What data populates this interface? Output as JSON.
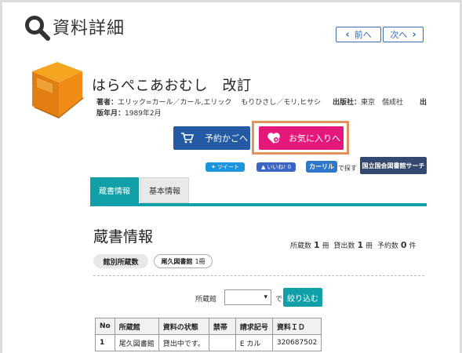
{
  "header": {
    "title": "資料詳細",
    "prev_label": "前へ",
    "next_label": "次へ"
  },
  "book": {
    "title": "はらぺこあおむし　改訂",
    "author_label": "著者：",
    "author_value": "エリック=カール／カール,エリック　 もりひさし／モリ,ヒサシ",
    "publisher_label": "出版社：",
    "publisher_value": "東京　偕成社",
    "publisher_overflow": "出",
    "date_label": "版年月：",
    "date_value": "1989年2月"
  },
  "actions": {
    "cart_label": "予約かごへ",
    "favorite_label": "お気に入りへ"
  },
  "social": {
    "tweet_label": "ツイート",
    "like_label": "いいね! 0",
    "calil_label": "カーリル",
    "calil_suffix": "で探す",
    "ndl_label": "国立国会図書館サーチ"
  },
  "tabs": [
    {
      "label": "蔵書情報",
      "active": true
    },
    {
      "label": "基本情報",
      "active": false
    }
  ],
  "holdings": {
    "title": "蔵書情報",
    "counts": {
      "owned_label": "所蔵数",
      "owned_value": "1",
      "owned_unit": "冊",
      "loaned_label": "貸出数",
      "loaned_value": "1",
      "loaned_unit": "冊",
      "reserved_label": "予約数",
      "reserved_value": "0",
      "reserved_unit": "件"
    },
    "by_library_label": "館別所蔵数",
    "library_pill_name": "尾久図書館",
    "library_pill_count": "1冊",
    "filter_label": "所蔵館",
    "filter_selected": "",
    "filter_de": "で",
    "filter_button": "絞り込む",
    "table": {
      "headers": [
        "No",
        "所蔵館",
        "資料の状態",
        "禁帯",
        "請求記号",
        "資料ＩＤ"
      ],
      "rows": [
        [
          "1",
          "尾久図書館",
          "貸出中です。",
          "",
          "E カル",
          "320687502"
        ]
      ]
    }
  },
  "colors": {
    "accent_teal": "#12a0a8",
    "cart_blue": "#245aa4",
    "favorite_pink": "#e3187a",
    "highlight_orange": "#e0935a",
    "nav_blue": "#3b6cb5"
  }
}
